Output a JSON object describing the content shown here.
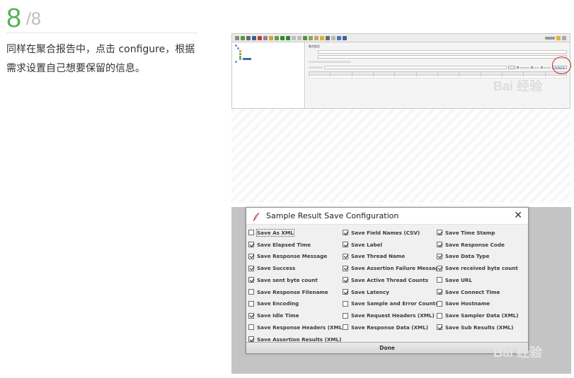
{
  "step": {
    "number": "8",
    "total": "/8"
  },
  "instruction": "同样在聚合报告中，点击 configure，根据需求设置自己想要保留的信息。",
  "jmeter": {
    "panel_title": "聚合报告",
    "configure_button": "Configure"
  },
  "dialog": {
    "title": "Sample Result Save Configuration",
    "close_glyph": "✕",
    "done_label": "Done",
    "options": [
      {
        "label": "Save As XML",
        "checked": false,
        "focused": true
      },
      {
        "label": "Save Field Names (CSV)",
        "checked": true
      },
      {
        "label": "Save Time Stamp",
        "checked": true
      },
      {
        "label": "Save Elapsed Time",
        "checked": true
      },
      {
        "label": "Save Label",
        "checked": true
      },
      {
        "label": "Save Response Code",
        "checked": true
      },
      {
        "label": "Save Response Message",
        "checked": true
      },
      {
        "label": "Save Thread Name",
        "checked": true
      },
      {
        "label": "Save Data Type",
        "checked": true
      },
      {
        "label": "Save Success",
        "checked": true
      },
      {
        "label": "Save Assertion Failure Message",
        "checked": true
      },
      {
        "label": "Save received byte count",
        "checked": true
      },
      {
        "label": "Save sent byte count",
        "checked": true
      },
      {
        "label": "Save Active Thread Counts",
        "checked": true
      },
      {
        "label": "Save URL",
        "checked": false
      },
      {
        "label": "Save Response Filename",
        "checked": false
      },
      {
        "label": "Save Latency",
        "checked": true
      },
      {
        "label": "Save Connect Time",
        "checked": true
      },
      {
        "label": "Save Encoding",
        "checked": false
      },
      {
        "label": "Save Sample and Error Counts",
        "checked": false
      },
      {
        "label": "Save Hostname",
        "checked": false
      },
      {
        "label": "Save Idle Time",
        "checked": true
      },
      {
        "label": "Save Request Headers (XML)",
        "checked": false
      },
      {
        "label": "Save Sampler Data (XML)",
        "checked": false
      },
      {
        "label": "Save Response Headers (XML)",
        "checked": false
      },
      {
        "label": "Save Response Data (XML)",
        "checked": false
      },
      {
        "label": "Save Sub Results (XML)",
        "checked": true
      },
      {
        "label": "Save Assertion Results (XML)",
        "checked": true
      }
    ]
  },
  "watermark": "Bai 经验",
  "colors": {
    "step_green": "#59b255",
    "annotation_red": "#d2211e"
  }
}
